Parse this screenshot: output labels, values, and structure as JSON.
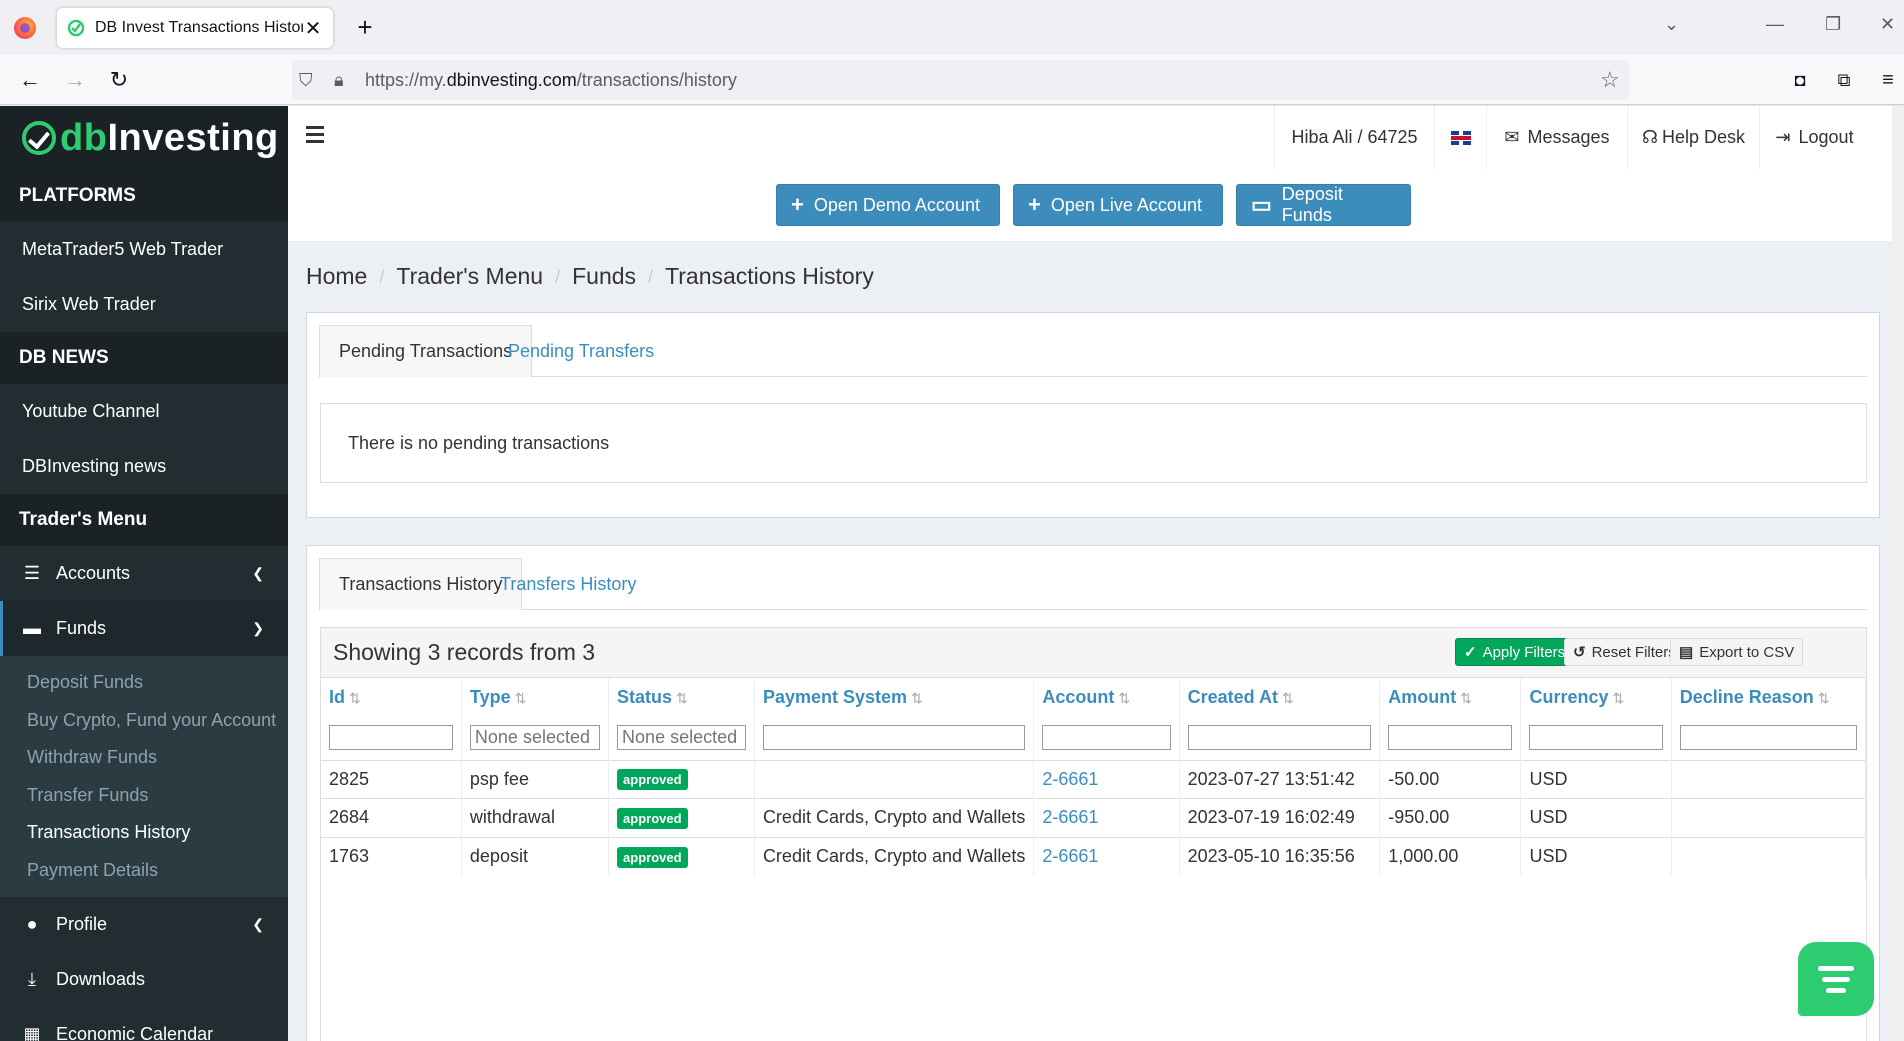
{
  "browser": {
    "tab_title": "DB Invest Transactions History",
    "url_prefix": "https://my.",
    "url_domain": "dbinvesting.com",
    "url_path": "/transactions/history"
  },
  "sidebar": {
    "logo_db": "db",
    "logo_rest": "Investing",
    "platforms_header": "PLATFORMS",
    "platforms": [
      "MetaTrader5 Web Trader",
      "Sirix Web Trader"
    ],
    "news_header": "DB NEWS",
    "news": [
      "Youtube Channel",
      "DBInvesting news"
    ],
    "traders_header": "Trader's Menu",
    "menu": {
      "accounts": "Accounts",
      "funds": "Funds",
      "profile": "Profile",
      "downloads": "Downloads",
      "calendar": "Economic Calendar"
    },
    "funds_sub": [
      "Deposit Funds",
      "Buy Crypto, Fund your Account",
      "Withdraw Funds",
      "Transfer Funds",
      "Transactions History",
      "Payment Details"
    ]
  },
  "header": {
    "user": "Hiba Ali / 64725",
    "messages": "Messages",
    "helpdesk": "Help Desk",
    "logout": "Logout"
  },
  "actions": {
    "demo": "Open Demo Account",
    "live": "Open Live Account",
    "deposit": "Deposit Funds"
  },
  "breadcrumb": [
    "Home",
    "Trader's Menu",
    "Funds",
    "Transactions History"
  ],
  "pending": {
    "tab_active": "Pending Transactions",
    "tab_other": "Pending Transfers",
    "empty_text": "There is no pending transactions"
  },
  "history": {
    "tab_active": "Transactions History",
    "tab_other": "Transfers History",
    "showing": "Showing 3 records from 3",
    "apply": "Apply Filters",
    "reset": "Reset Filters",
    "export": "Export to CSV",
    "columns": [
      "Id",
      "Type",
      "Status",
      "Payment System",
      "Account",
      "Created At",
      "Amount",
      "Currency",
      "Decline Reason"
    ],
    "filter_placeholder": "None selected",
    "rows": [
      {
        "id": "2825",
        "type": "psp fee",
        "status": "approved",
        "payment": "",
        "account": "2-6661",
        "created": "2023-07-27 13:51:42",
        "amount": "-50.00",
        "currency": "USD",
        "decline": ""
      },
      {
        "id": "2684",
        "type": "withdrawal",
        "status": "approved",
        "payment": "Credit Cards, Crypto and Wallets",
        "account": "2-6661",
        "created": "2023-07-19 16:02:49",
        "amount": "-950.00",
        "currency": "USD",
        "decline": ""
      },
      {
        "id": "1763",
        "type": "deposit",
        "status": "approved",
        "payment": "Credit Cards, Crypto and Wallets",
        "account": "2-6661",
        "created": "2023-05-10 16:35:56",
        "amount": "1,000.00",
        "currency": "USD",
        "decline": ""
      }
    ]
  },
  "colors": {
    "accent": "#3c8dbc",
    "success": "#00a65a",
    "sidebar": "#222d32",
    "brand_green": "#2ecc71"
  }
}
